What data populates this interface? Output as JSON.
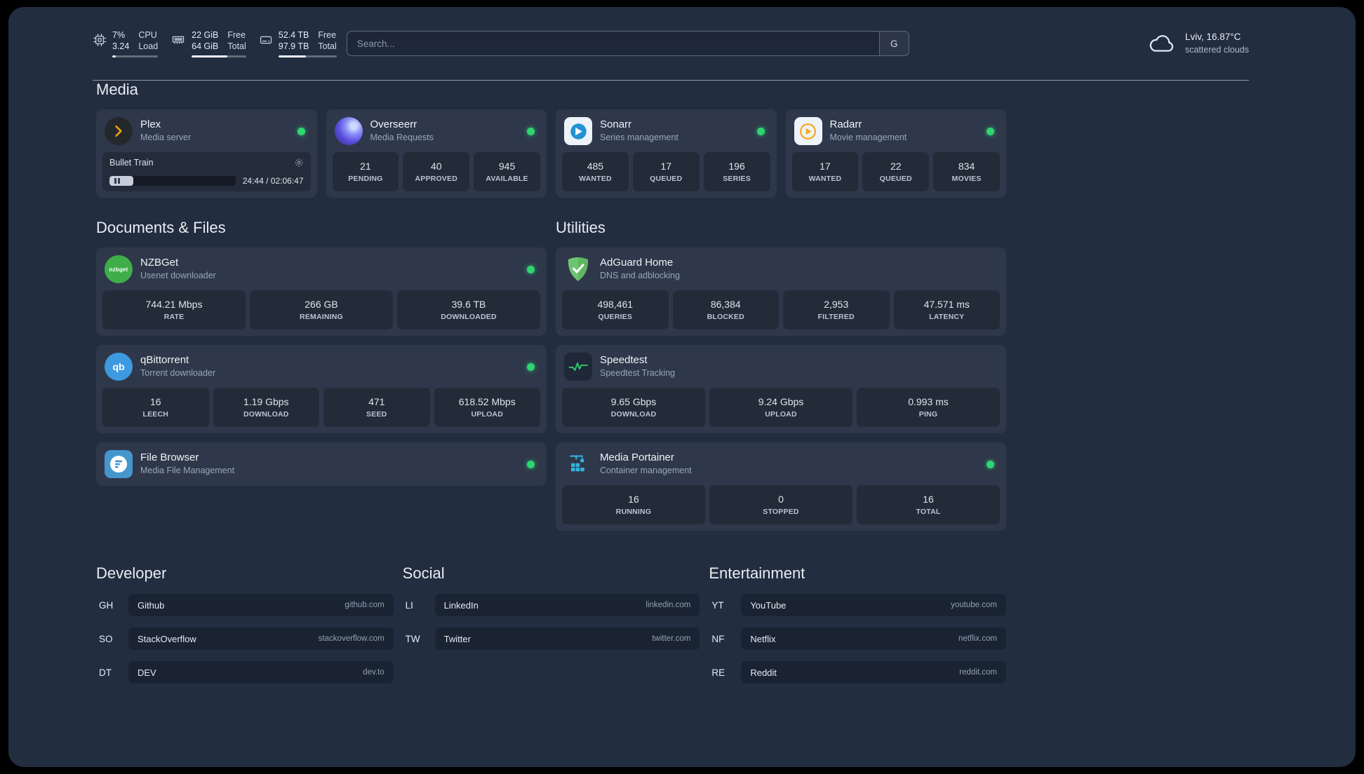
{
  "header": {
    "cpu": {
      "usage": "7%",
      "load": "3.24",
      "labels": [
        "CPU",
        "Load"
      ],
      "bar_percent": 7
    },
    "memory": {
      "free": "22 GiB",
      "total": "64 GiB",
      "labels": [
        "Free",
        "Total"
      ],
      "bar_percent": 66
    },
    "disk": {
      "free": "52.4 TB",
      "total": "97.9 TB",
      "labels": [
        "Free",
        "Total"
      ],
      "bar_percent": 47
    },
    "search": {
      "placeholder": "Search...",
      "provider_label": "G"
    },
    "weather": {
      "location_temp": "Lviv, 16.87°C",
      "condition": "scattered clouds"
    }
  },
  "groups": {
    "media": {
      "title": "Media",
      "cards": {
        "plex": {
          "name": "Plex",
          "desc": "Media server",
          "status": "online",
          "player": {
            "track_title": "Bullet Train",
            "time": "24:44 / 02:06:47",
            "progress_percent": 19
          }
        },
        "overseerr": {
          "name": "Overseerr",
          "desc": "Media Requests",
          "status": "online",
          "stats": [
            {
              "value": "21",
              "label": "PENDING"
            },
            {
              "value": "40",
              "label": "APPROVED"
            },
            {
              "value": "945",
              "label": "AVAILABLE"
            }
          ]
        },
        "sonarr": {
          "name": "Sonarr",
          "desc": "Series management",
          "status": "online",
          "stats": [
            {
              "value": "485",
              "label": "WANTED"
            },
            {
              "value": "17",
              "label": "QUEUED"
            },
            {
              "value": "196",
              "label": "SERIES"
            }
          ]
        },
        "radarr": {
          "name": "Radarr",
          "desc": "Movie management",
          "status": "online",
          "stats": [
            {
              "value": "17",
              "label": "WANTED"
            },
            {
              "value": "22",
              "label": "QUEUED"
            },
            {
              "value": "834",
              "label": "MOVIES"
            }
          ]
        }
      }
    },
    "documents": {
      "title": "Documents & Files",
      "cards": {
        "nzbget": {
          "name": "NZBGet",
          "desc": "Usenet downloader",
          "status": "online",
          "icon_text": "nzbget",
          "stats": [
            {
              "value": "744.21 Mbps",
              "label": "RATE"
            },
            {
              "value": "266 GB",
              "label": "REMAINING"
            },
            {
              "value": "39.6 TB",
              "label": "DOWNLOADED"
            }
          ]
        },
        "qbittorrent": {
          "name": "qBittorrent",
          "desc": "Torrent downloader",
          "status": "online",
          "icon_text": "qb",
          "stats": [
            {
              "value": "16",
              "label": "LEECH"
            },
            {
              "value": "1.19 Gbps",
              "label": "DOWNLOAD"
            },
            {
              "value": "471",
              "label": "SEED"
            },
            {
              "value": "618.52 Mbps",
              "label": "UPLOAD"
            }
          ]
        },
        "filebrowser": {
          "name": "File Browser",
          "desc": "Media File Management",
          "status": "online"
        }
      }
    },
    "utilities": {
      "title": "Utilities",
      "cards": {
        "adguard": {
          "name": "AdGuard Home",
          "desc": "DNS and adblocking",
          "stats": [
            {
              "value": "498,461",
              "label": "QUERIES"
            },
            {
              "value": "86,384",
              "label": "BLOCKED"
            },
            {
              "value": "2,953",
              "label": "FILTERED"
            },
            {
              "value": "47.571 ms",
              "label": "LATENCY"
            }
          ]
        },
        "speedtest": {
          "name": "Speedtest",
          "desc": "Speedtest Tracking",
          "stats": [
            {
              "value": "9.65 Gbps",
              "label": "DOWNLOAD"
            },
            {
              "value": "9.24 Gbps",
              "label": "UPLOAD"
            },
            {
              "value": "0.993 ms",
              "label": "PING"
            }
          ]
        },
        "portainer": {
          "name": "Media Portainer",
          "desc": "Container management",
          "status": "online",
          "stats": [
            {
              "value": "16",
              "label": "RUNNING"
            },
            {
              "value": "0",
              "label": "STOPPED"
            },
            {
              "value": "16",
              "label": "TOTAL"
            }
          ]
        }
      }
    }
  },
  "bookmarks": [
    {
      "title": "Developer",
      "items": [
        {
          "abbr": "GH",
          "name": "Github",
          "domain": "github.com"
        },
        {
          "abbr": "SO",
          "name": "StackOverflow",
          "domain": "stackoverflow.com"
        },
        {
          "abbr": "DT",
          "name": "DEV",
          "domain": "dev.to"
        }
      ]
    },
    {
      "title": "Social",
      "items": [
        {
          "abbr": "LI",
          "name": "LinkedIn",
          "domain": "linkedin.com"
        },
        {
          "abbr": "TW",
          "name": "Twitter",
          "domain": "twitter.com"
        }
      ]
    },
    {
      "title": "Entertainment",
      "items": [
        {
          "abbr": "YT",
          "name": "YouTube",
          "domain": "youtube.com"
        },
        {
          "abbr": "NF",
          "name": "Netflix",
          "domain": "netflix.com"
        },
        {
          "abbr": "RE",
          "name": "Reddit",
          "domain": "reddit.com"
        }
      ]
    }
  ],
  "colors": {
    "status_online": "#2fd571",
    "plex_amber": "#e5a00d",
    "overseerr_purple": "#584ddb",
    "sonarr_blue": "#2193d3",
    "radarr_amber": "#f7a823",
    "nzbget_green": "#3fae49",
    "qbittorrent_blue": "#3d9ae0",
    "filebrowser_blue": "#4596cd",
    "adguard_green": "#5fb760",
    "speedtest_green": "#2fd571",
    "portainer_blue": "#33b3e2"
  }
}
